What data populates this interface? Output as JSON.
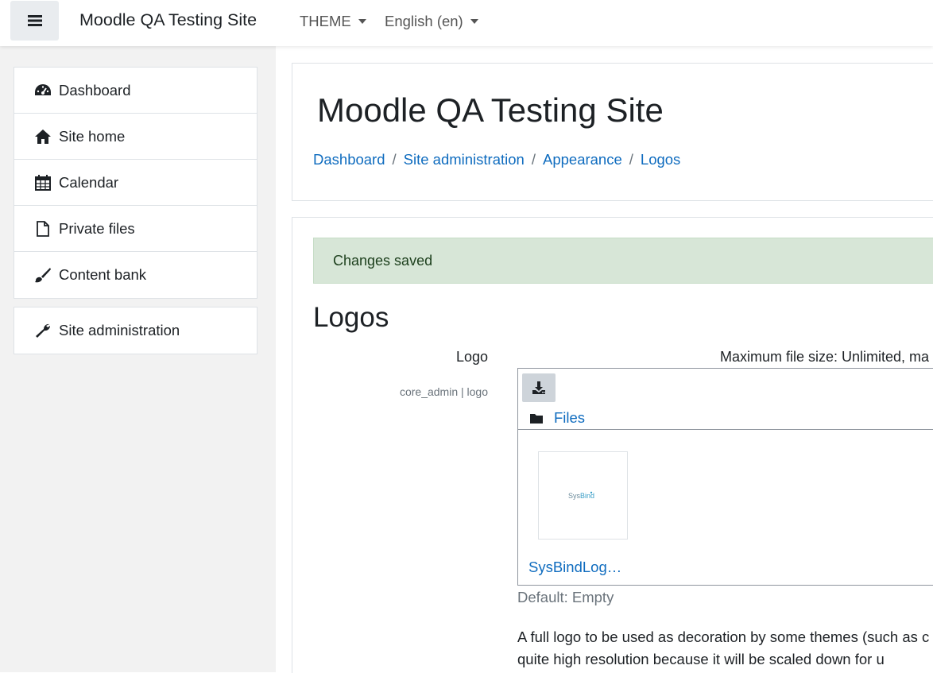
{
  "navbar": {
    "site_name": "Moodle QA Testing Site",
    "theme_menu": "THEME",
    "language_menu": "English (en)"
  },
  "drawer": {
    "items": [
      {
        "label": "Dashboard",
        "icon": "dashboard-icon"
      },
      {
        "label": "Site home",
        "icon": "home-icon"
      },
      {
        "label": "Calendar",
        "icon": "calendar-icon"
      },
      {
        "label": "Private files",
        "icon": "file-icon"
      },
      {
        "label": "Content bank",
        "icon": "paintbrush-icon"
      }
    ],
    "admin_item": {
      "label": "Site administration",
      "icon": "wrench-icon"
    }
  },
  "header": {
    "title": "Moodle QA Testing Site",
    "breadcrumb": [
      "Dashboard",
      "Site administration",
      "Appearance",
      "Logos"
    ]
  },
  "content": {
    "alert": "Changes saved",
    "section_title": "Logos",
    "setting": {
      "label": "Logo",
      "name": "core_admin | logo",
      "max_size": "Maximum file size: Unlimited, ma",
      "filemanager": {
        "path_label": "Files",
        "thumb_text": "SysBind",
        "filename": "SysBindLog…"
      },
      "default": "Default: Empty",
      "description": "A full logo to be used as decoration by some themes (such as c can be quite high resolution because it will be scaled down for u"
    }
  },
  "colors": {
    "link": "#0f6cbf",
    "alert_bg": "#d7e6d7",
    "drawer_bg": "#f2f2f2"
  }
}
